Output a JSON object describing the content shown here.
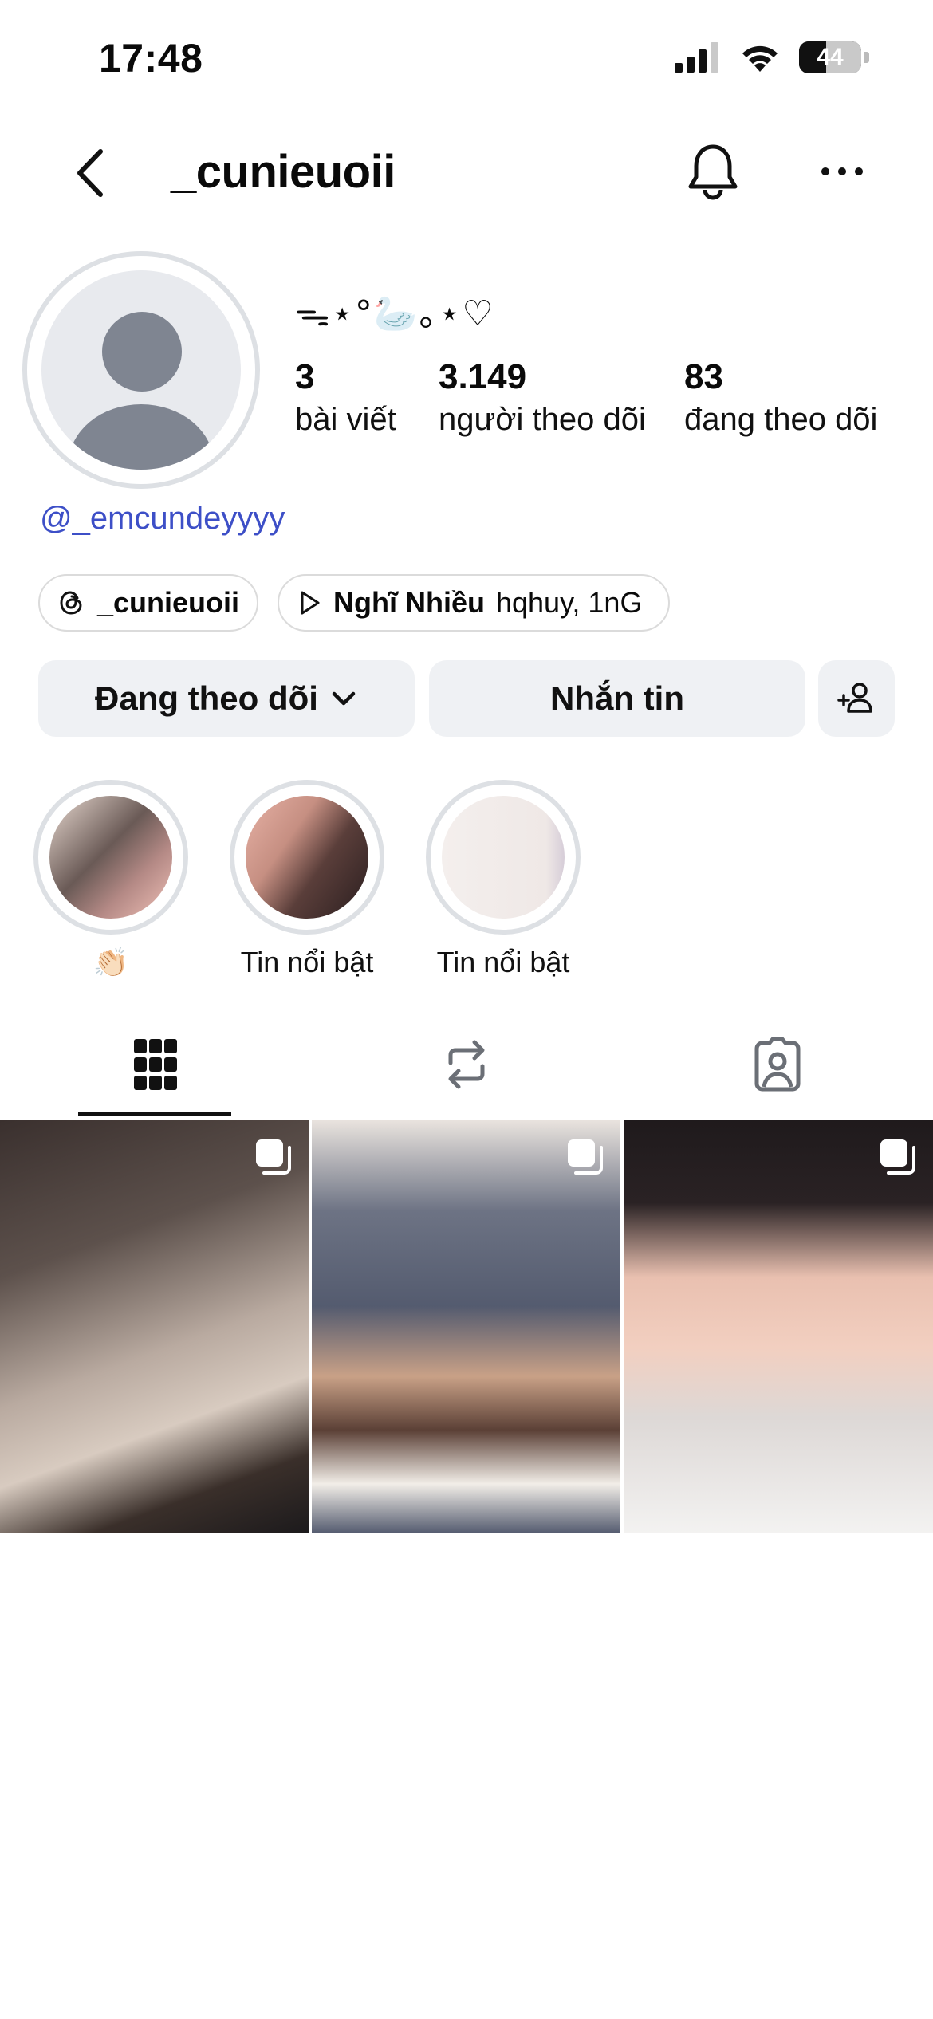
{
  "status_bar": {
    "time": "17:48",
    "battery": "44"
  },
  "header": {
    "username": "_cunieuoii",
    "icons": [
      "chevron-left-icon",
      "bell-icon",
      "more-horizontal-icon"
    ]
  },
  "profile": {
    "display_name": "ᯓ⋆°🦢｡⋆♡",
    "stats": [
      {
        "value": "3",
        "label": "bài viết"
      },
      {
        "value": "3.149",
        "label": "người theo dõi"
      },
      {
        "value": "83",
        "label": "đang theo dõi"
      }
    ],
    "bio_mention": "@_emcundeyyyy"
  },
  "chips": {
    "threads": {
      "handle": "_cunieuoii",
      "icon": "threads-icon"
    },
    "music": {
      "song": "Nghĩ Nhiều",
      "artist": "hqhuy, 1nG",
      "icon": "play-icon"
    }
  },
  "actions": {
    "following_label": "Đang theo dõi",
    "message_label": "Nhắn tin",
    "suggest_icon": "add-person-icon"
  },
  "highlights": [
    {
      "caption": "👏🏻"
    },
    {
      "caption": "Tin nổi bật"
    },
    {
      "caption": "Tin nổi bật"
    }
  ],
  "tabs": [
    "grid-icon",
    "reposts-icon",
    "tagged-icon"
  ],
  "colors": {
    "link": "#3d4fc7",
    "button_bg": "#eff1f4",
    "ring": "#dde0e4"
  }
}
